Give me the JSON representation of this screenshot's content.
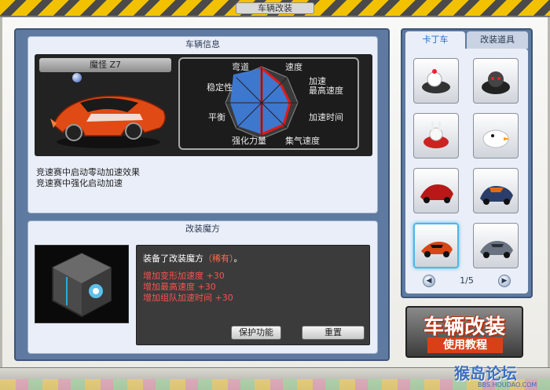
{
  "window": {
    "title": "车辆改装"
  },
  "vehicle_info": {
    "header": "车辆信息",
    "car_name": "魔怪 Z7",
    "stats_labels": {
      "corner": "弯道",
      "speed": "速度",
      "accel": "加速",
      "max_speed": "最高速度",
      "accel_time": "加速时间",
      "nitro_speed": "集气速度",
      "boost_power": "强化力量",
      "balance": "平衡",
      "stability": "稳定性"
    },
    "descriptions": [
      "竞速赛中启动零动加速效果",
      "竞速赛中强化启动加速"
    ]
  },
  "mod_cube": {
    "header": "改装魔方",
    "equipped_prefix": "装备了改装魔方",
    "rarity": "（稀有）",
    "equipped_suffix": "。",
    "bonuses": [
      "增加变形加速度 +30",
      "增加最高速度 +30",
      "增加组队加速时间 +30"
    ],
    "buttons": {
      "protect": "保护功能",
      "reset": "重置"
    }
  },
  "side": {
    "tabs": [
      "卡丁车",
      "改装道具"
    ],
    "active_tab": 0,
    "slot_icons": [
      "chicken-kart",
      "cat-kart",
      "rabbit-kart",
      "penguin-kart",
      "red-racer",
      "blue-racer",
      "demon-z7",
      "silver-racer"
    ],
    "selected_slot": 6,
    "pager": {
      "text": "1/5"
    }
  },
  "tutorial": {
    "main": "车辆改装",
    "sub": "使用教程"
  },
  "watermark": {
    "logo": "猴岛论坛",
    "url": "BBS.HOUDAO.COM"
  },
  "colors": {
    "accent": "#4ab8e8",
    "rare": "#ff6b4a",
    "bonus": "#ff5050",
    "panel": "#5e7aa0",
    "radar_fill": "#3d7bd6",
    "radar_edge": "#e01a1a"
  }
}
